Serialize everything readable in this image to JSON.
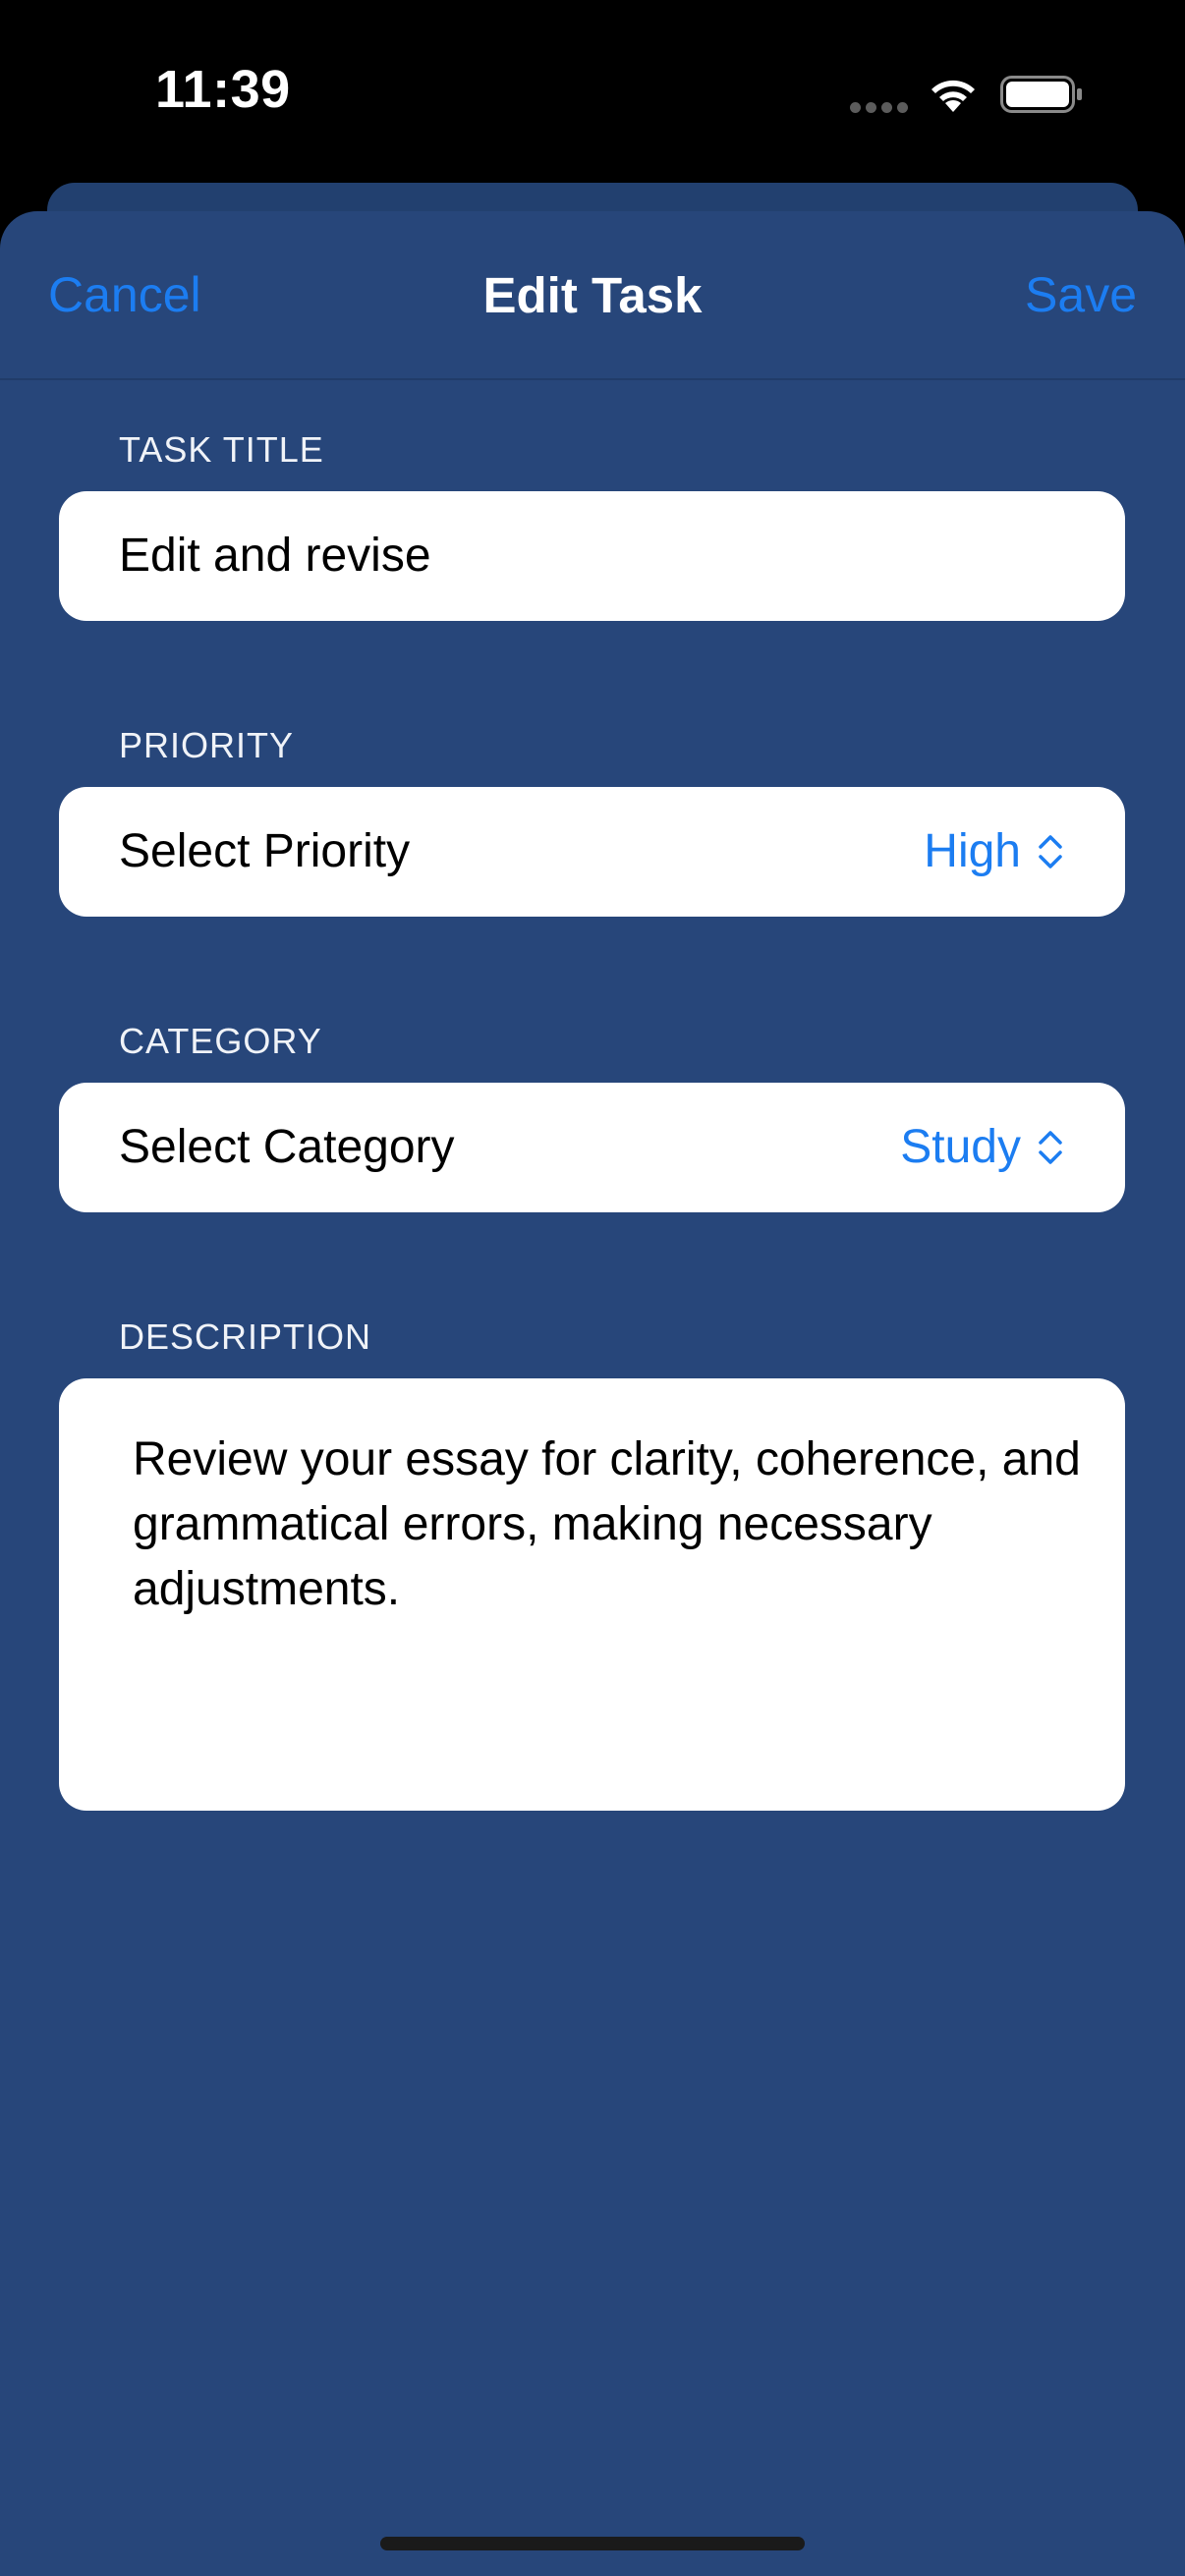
{
  "status_bar": {
    "time": "11:39",
    "icons": [
      "cellular-dots-icon",
      "wifi-icon",
      "battery-icon"
    ]
  },
  "nav": {
    "cancel_label": "Cancel",
    "title": "Edit Task",
    "save_label": "Save"
  },
  "form": {
    "task_title": {
      "header": "TASK TITLE",
      "value": "Edit and revise"
    },
    "priority": {
      "header": "PRIORITY",
      "label": "Select Priority",
      "value": "High"
    },
    "category": {
      "header": "CATEGORY",
      "label": "Select Category",
      "value": "Study"
    },
    "description": {
      "header": "DESCRIPTION",
      "value": "Review your essay for clarity, coherence, and grammatical errors, making necessary adjustments."
    }
  },
  "colors": {
    "sheet_background": "#27467a",
    "accent": "#1c7df1",
    "card_background": "#ffffff"
  }
}
